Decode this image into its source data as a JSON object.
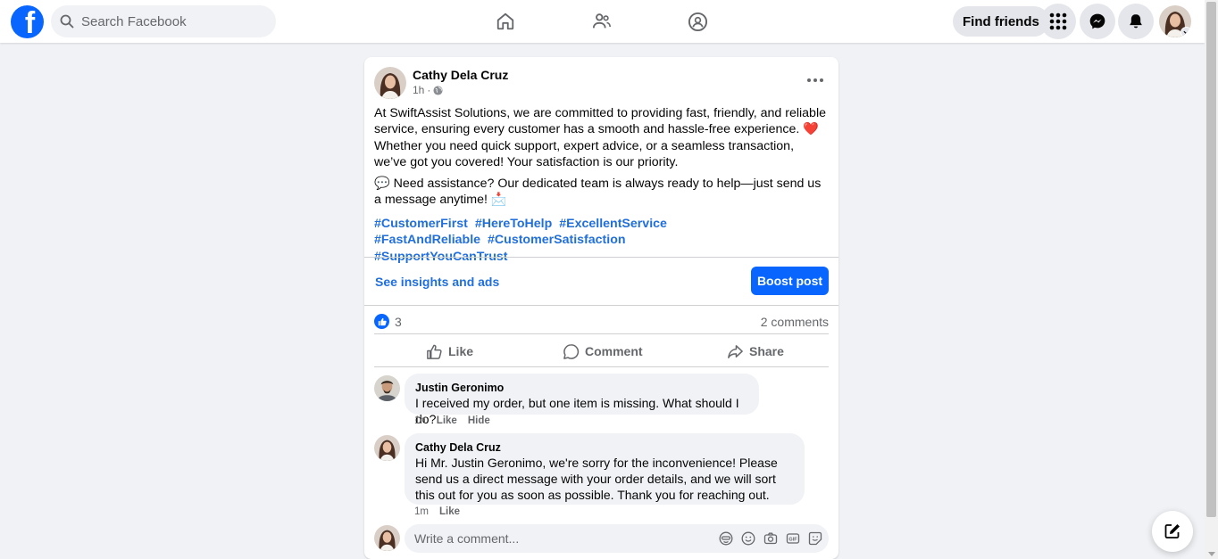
{
  "colors": {
    "brand": "#0866ff",
    "link": "#216fdb",
    "secondary_text": "#65676b"
  },
  "topbar": {
    "logo_glyph": "f",
    "search_placeholder": "Search Facebook",
    "nav_icons": [
      "home-icon",
      "friends-icon",
      "groups-icon"
    ],
    "find_friends_label": "Find friends",
    "right_icons": [
      "menu-grid-icon",
      "messenger-icon",
      "notifications-icon"
    ]
  },
  "post": {
    "author": "Cathy Dela Cruz",
    "time": "1h",
    "separator": "·",
    "privacy_icon": "globe-icon",
    "paragraph_1": "At SwiftAssist Solutions, we are committed to providing fast, friendly, and reliable service, ensuring every customer has a smooth and hassle-free experience. ❤️ Whether you need quick support, expert advice, or a seamless transaction, we’ve got you covered! Your satisfaction is our priority.",
    "paragraph_2": "💬 Need assistance? Our dedicated team is always ready to help—just send us a message anytime! 📩",
    "hashtags": [
      "#CustomerFirst",
      "#HereToHelp",
      "#ExcellentService",
      "#FastAndReliable",
      "#CustomerSatisfaction",
      "#SupportYouCanTrust"
    ],
    "insights_label": "See insights and ads",
    "boost_label": "Boost post",
    "reaction_count": "3",
    "comments_count": "2 comments",
    "actions": {
      "like": "Like",
      "comment": "Comment",
      "share": "Share"
    }
  },
  "comments": [
    {
      "author": "Justin Geronimo",
      "text": "I received my order, but one item is missing. What should I do?",
      "time": "1h",
      "like": "Like",
      "hide": "Hide"
    },
    {
      "author": "Cathy Dela Cruz",
      "text": "Hi Mr. Justin Geronimo, we're sorry for the inconvenience! Please send us a direct message with your order details, and we will sort this out for you as soon as possible. Thank you for reaching out.",
      "time": "1m",
      "like": "Like"
    }
  ],
  "composer": {
    "placeholder": "Write a comment...",
    "icons": [
      "avatar-sticker-icon",
      "emoji-icon",
      "camera-icon",
      "gif-icon",
      "sticker-icon"
    ]
  }
}
